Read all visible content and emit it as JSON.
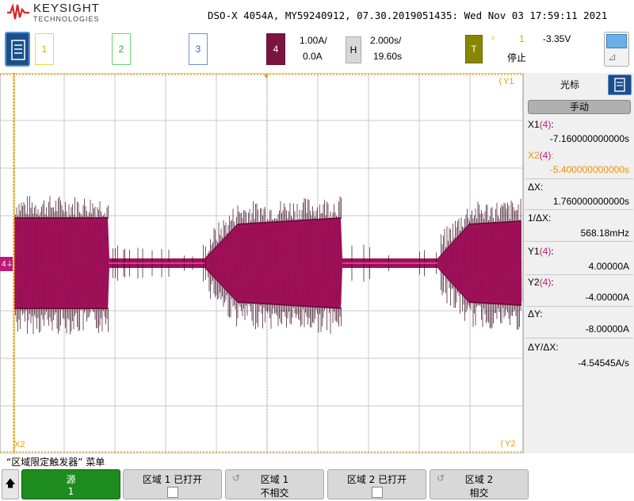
{
  "header": {
    "brand": "KEYSIGHT",
    "brand_sub": "TECHNOLOGIES",
    "title": "DSO-X 4054A, MY59240912, 07.30.2019051435: Wed Nov 03 17:59:11 2021"
  },
  "channels": {
    "ch1_label": "1",
    "ch2_label": "2",
    "ch3_label": "3",
    "ch4_label": "4",
    "ch4_scale": "1.00A/",
    "ch4_offset": "0.0A"
  },
  "horizontal": {
    "label": "H",
    "scale": "2.000s/",
    "delay": "19.60s"
  },
  "trigger": {
    "label": "T",
    "source": "1",
    "level": "-3.35V",
    "status": "停止"
  },
  "markers": {
    "y1": "Y1",
    "y2": "Y2",
    "x2": "X2",
    "ch4_ground": "4"
  },
  "cursor_panel": {
    "title": "光标",
    "mode": "手动",
    "x1_label": "X1",
    "x1_src": "(4)",
    "x1_value": "-7.160000000000s",
    "x2_label": "X2",
    "x2_src": "(4)",
    "x2_value": "-5.400000000000s",
    "dx_label": "ΔX:",
    "dx_value": "1.760000000000s",
    "inv_dx_label": "1/ΔX:",
    "inv_dx_value": "568.18mHz",
    "y1_label": "Y1",
    "y1_src": "(4)",
    "y1_value": "4.00000A",
    "y2_label": "Y2",
    "y2_src": "(4)",
    "y2_value": "-4.00000A",
    "dy_label": "ΔY:",
    "dy_value": "-8.00000A",
    "dydx_label": "ΔY/ΔX:",
    "dydx_value": "-4.54545A/s"
  },
  "softkeys": {
    "menu_title": "“区域限定触发器” 菜单",
    "sk1_l1": "源",
    "sk1_l2": "1",
    "sk2_l1": "区域 1 已打开",
    "sk3_l1": "区域 1",
    "sk3_l2": "不相交",
    "sk4_l1": "区域 2 已打开",
    "sk5_l1": "区域 2",
    "sk5_l2": "相交"
  },
  "colors": {
    "ch4": "#a0105a",
    "cursor": "#e89400",
    "grid": "#c8c8c8"
  }
}
